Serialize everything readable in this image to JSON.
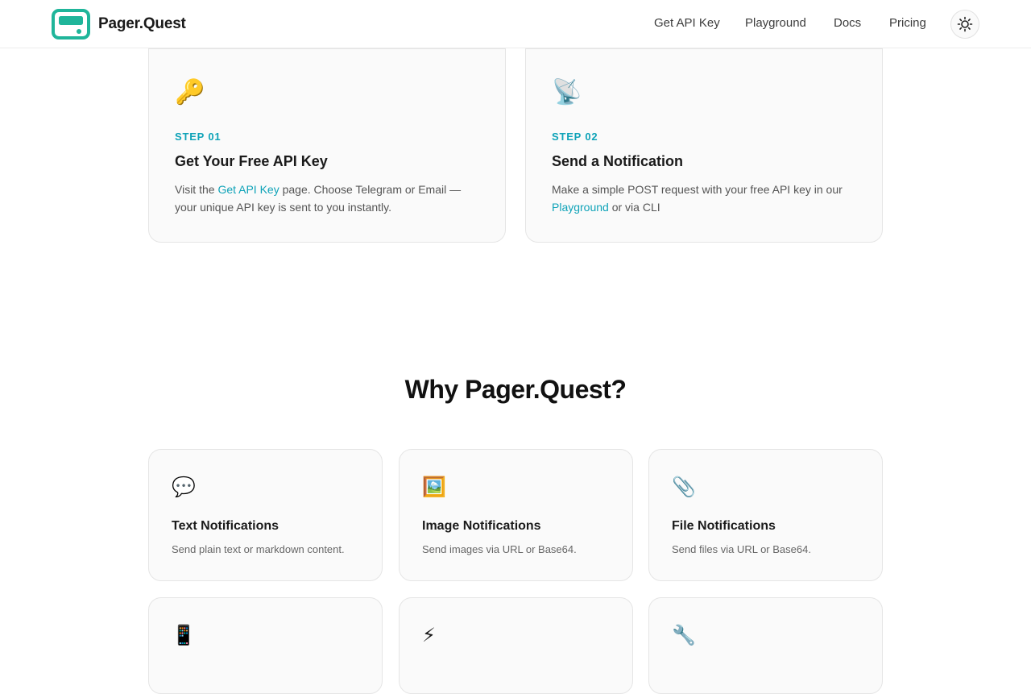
{
  "header": {
    "brand": "Pager.Quest",
    "nav": [
      "Get API Key",
      "Playground",
      "Docs",
      "Pricing"
    ]
  },
  "steps": [
    {
      "emoji": "🔑",
      "label": "STEP 01",
      "title": "Get Your Free API Key",
      "desc_before": "Visit the ",
      "desc_link": "Get API Key",
      "desc_after": " page. Choose Telegram or Email — your unique API key is sent to you instantly."
    },
    {
      "emoji": "📡",
      "label": "STEP 02",
      "title": "Send a Notification",
      "desc_before": "Make a simple POST request with your free API key in our ",
      "desc_link": "Playground",
      "desc_after": " or via CLI"
    }
  ],
  "why": {
    "title": "Why Pager.Quest?",
    "features": [
      {
        "emoji": "💬",
        "title": "Text Notifications",
        "desc": "Send plain text or markdown content."
      },
      {
        "emoji": "🖼️",
        "title": "Image Notifications",
        "desc": "Send images via URL or Base64."
      },
      {
        "emoji": "📎",
        "title": "File Notifications",
        "desc": "Send files via URL or Base64."
      },
      {
        "emoji": "📱"
      },
      {
        "emoji": "⚡"
      },
      {
        "emoji": "🔧"
      }
    ]
  },
  "colors": {
    "accent": "#0fa3b8",
    "brand": "#1fb59a"
  }
}
